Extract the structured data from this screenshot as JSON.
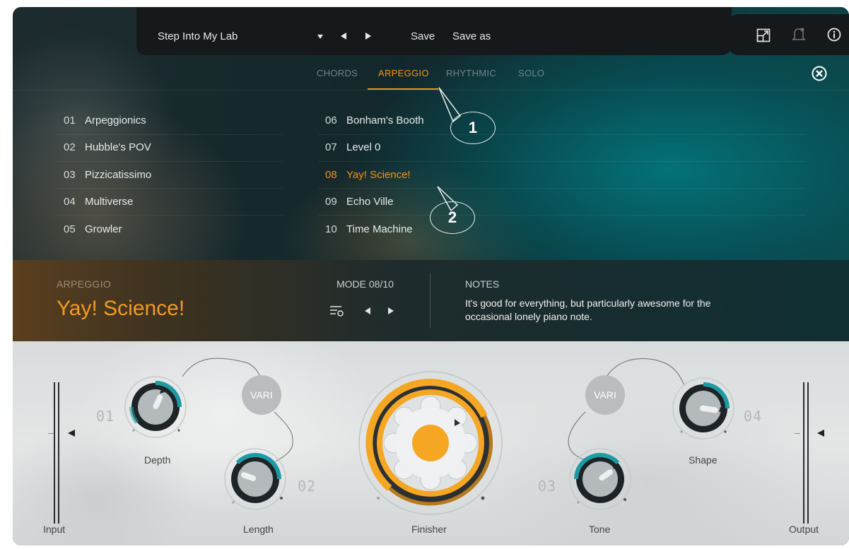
{
  "topbar": {
    "preset_name": "Step Into My Lab",
    "save_label": "Save",
    "save_as_label": "Save as"
  },
  "icons": {
    "dropdown": "chevron-down-icon",
    "prev": "arrow-left-icon",
    "next": "arrow-right-icon",
    "resize": "resize-icon",
    "notifications": "bell-icon",
    "info": "info-icon",
    "close": "close-icon",
    "mode_list": "list-icon"
  },
  "tabs": [
    {
      "label": "CHORDS",
      "active": false
    },
    {
      "label": "ARPEGGIO",
      "active": true
    },
    {
      "label": "RHYTHMIC",
      "active": false
    },
    {
      "label": "SOLO",
      "active": false
    }
  ],
  "presets_left": [
    {
      "num": "01",
      "name": "Arpeggionics"
    },
    {
      "num": "02",
      "name": "Hubble's POV"
    },
    {
      "num": "03",
      "name": "Pizzicatissimo"
    },
    {
      "num": "04",
      "name": "Multiverse"
    },
    {
      "num": "05",
      "name": "Growler"
    }
  ],
  "presets_right": [
    {
      "num": "06",
      "name": "Bonham's Booth"
    },
    {
      "num": "07",
      "name": "Level 0"
    },
    {
      "num": "08",
      "name": "Yay! Science!",
      "selected": true
    },
    {
      "num": "09",
      "name": "Echo Ville"
    },
    {
      "num": "10",
      "name": "Time Machine"
    }
  ],
  "callouts": [
    "1",
    "2"
  ],
  "info": {
    "category": "ARPEGGIO",
    "name": "Yay! Science!",
    "mode_label": "MODE 08/10",
    "notes_label": "NOTES",
    "notes_text": "It's good for everything, but particularly awesome for the occasional lonely piano note."
  },
  "controls": {
    "input_label": "Input",
    "output_label": "Output",
    "depth_label": "Depth",
    "length_label": "Length",
    "finisher_label": "Finisher",
    "tone_label": "Tone",
    "shape_label": "Shape",
    "vari_label": "VARI",
    "num_01": "01",
    "num_02": "02",
    "num_03": "03",
    "num_04": "04"
  },
  "colors": {
    "accent": "#f0941a",
    "knob_teal": "#1e9aa3",
    "finisher_orange": "#f5a623"
  }
}
